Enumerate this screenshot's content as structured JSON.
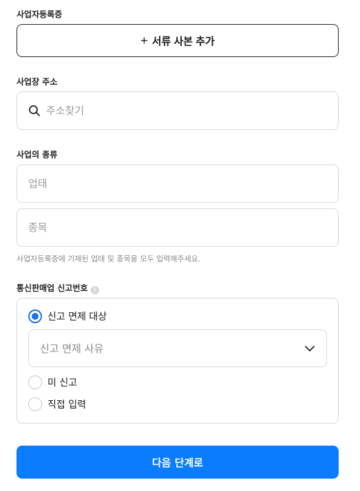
{
  "registration": {
    "label": "사업자등록증",
    "add_button_icon": "plus-icon",
    "add_button_label": "서류 사본 추가"
  },
  "address": {
    "label": "사업장 주소",
    "search_icon": "search-icon",
    "placeholder": "주소찾기"
  },
  "business_type": {
    "label": "사업의 종류",
    "category_placeholder": "업태",
    "item_placeholder": "종목",
    "helper": "사업자등록증에 기재된 업태 및 종목을 모두 입력해주세요."
  },
  "mail_order": {
    "label": "통신판매업 신고번호",
    "info_icon": "info-icon",
    "options": [
      {
        "label": "신고 면제 대상",
        "checked": true
      },
      {
        "label": "미 신고",
        "checked": false
      },
      {
        "label": "직접 입력",
        "checked": false
      }
    ],
    "reason_select": {
      "placeholder": "신고 면제 사유",
      "icon": "chevron-down-icon"
    }
  },
  "next_button": {
    "label": "다음 단계로",
    "color": "#0a7cff"
  },
  "colors": {
    "accent": "#1a73e8",
    "border": "#d9d9d9",
    "helper_text": "#8a8a8a"
  }
}
